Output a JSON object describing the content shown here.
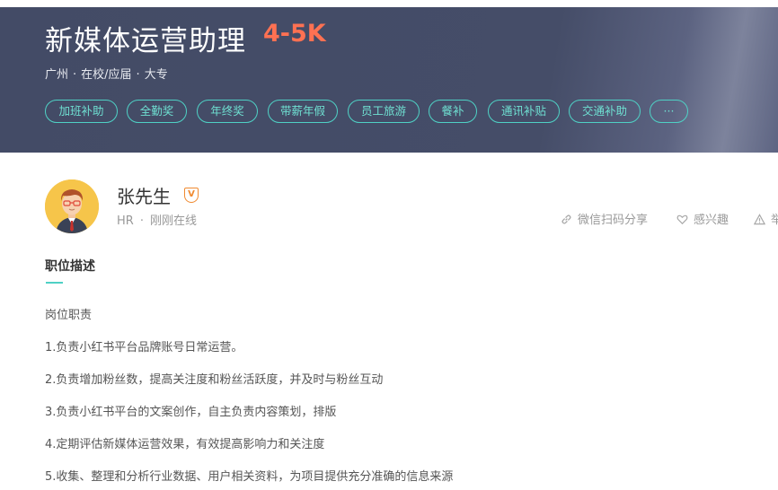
{
  "job": {
    "title": "新媒体运营助理",
    "salary": "4-5K",
    "meta": [
      "广州",
      "在校/应届",
      "大专"
    ],
    "meta_separator": "·"
  },
  "tags": [
    "加班补助",
    "全勤奖",
    "年终奖",
    "带薪年假",
    "员工旅游",
    "餐补",
    "通讯补贴",
    "交通补助",
    "···"
  ],
  "recruiter": {
    "name": "张先生",
    "badge": "V",
    "role": "HR",
    "separator": "·",
    "status": "刚刚在线"
  },
  "actions": {
    "share": "微信扫码分享",
    "interest": "感兴趣",
    "report": "举"
  },
  "section": {
    "title": "职位描述",
    "lines": [
      "岗位职责",
      "1.负责小红书平台品牌账号日常运营。",
      "2.负责增加粉丝数，提高关注度和粉丝活跃度，并及时与粉丝互动",
      "3.负责小红书平台的文案创作，自主负责内容策划，排版",
      "4.定期评估新媒体运营效果，有效提高影响力和关注度",
      "5.收集、整理和分析行业数据、用户相关资料，为项目提供充分准确的信息来源"
    ]
  },
  "colors": {
    "header_bg": "#454d68",
    "salary": "#ff7152",
    "tag_accent": "#4fd1c5",
    "badge": "#f08a30"
  }
}
